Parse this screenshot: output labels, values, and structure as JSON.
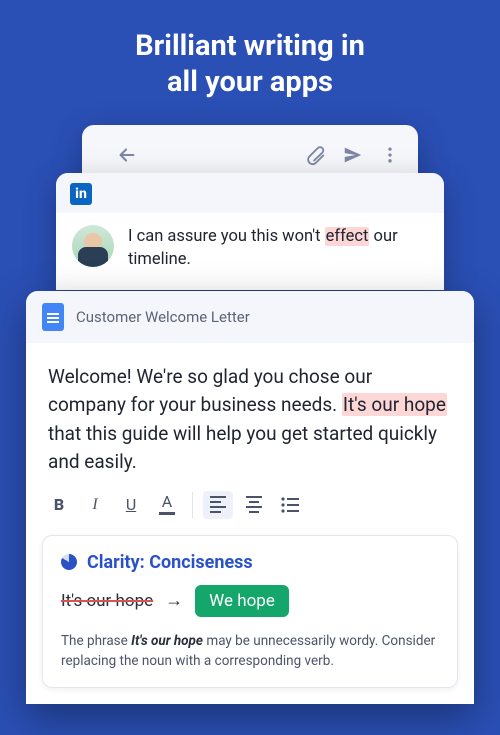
{
  "headline": {
    "line1": "Brilliant writing in",
    "line2": "all your apps"
  },
  "mail": {},
  "linkedin": {
    "logo_text": "in",
    "text_before": "I can assure you this won't ",
    "highlight": "effect",
    "text_after": " our timeline."
  },
  "doc": {
    "title": "Customer Welcome Letter",
    "body_before": "Welcome! We're so glad you chose our company for your business needs. ",
    "highlight": "It's our hope",
    "body_after": " that this guide will help you get started quickly and easily.",
    "toolbar": {
      "bold": "B",
      "italic": "I",
      "underline": "U",
      "fontcolor": "A"
    }
  },
  "suggestion": {
    "title": "Clarity: Conciseness",
    "from": "It's our hope",
    "arrow": "→",
    "to": "We hope",
    "desc_before": "The phrase ",
    "desc_em": "It's our hope",
    "desc_after": " may be unnecessarily wordy. Consider replacing the noun with a corresponding verb."
  }
}
